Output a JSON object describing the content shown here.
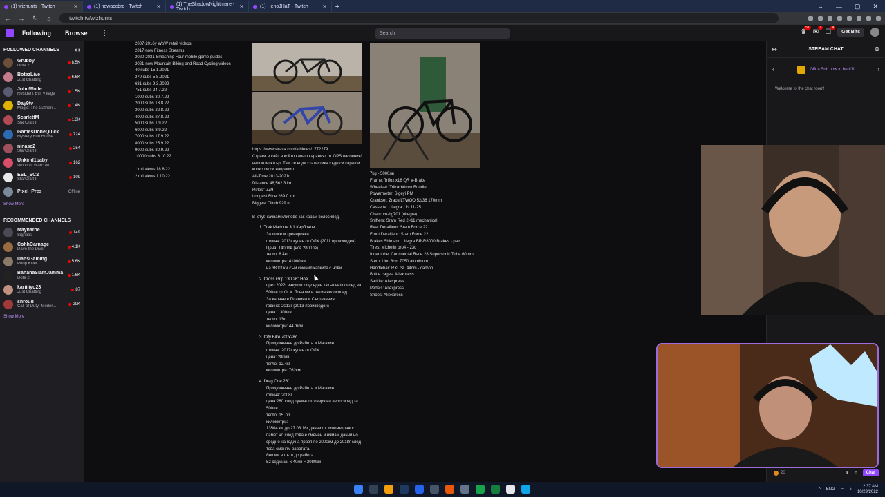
{
  "browser": {
    "tabs": [
      {
        "title": "(1) wizhunts - Twitch",
        "active": true
      },
      {
        "title": "(1) newaccbro - Twitch",
        "active": false
      },
      {
        "title": "(1) TheShadowNightmare - Twitch",
        "active": false
      },
      {
        "title": "(1) HenoJHaT - Twitch",
        "active": false
      }
    ],
    "new_tab_label": "+",
    "url": "twitch.tv/wizhunts",
    "window_controls": [
      "⌄",
      "—",
      "▢",
      "✕"
    ]
  },
  "topnav": {
    "following_label": "Following",
    "browse_label": "Browse",
    "more_label": "⋮",
    "search_placeholder": "Search",
    "search_icon": "search-icon",
    "notif_badges": [
      "51",
      "1",
      "4"
    ],
    "get_bits_label": "Get Bits"
  },
  "sidebar": {
    "followed_title": "FOLLOWED CHANNELS",
    "followed": [
      {
        "name": "Grubby",
        "game": "Dota 2",
        "viewers": "8.5K",
        "avatar_color": "#6b4f3a"
      },
      {
        "name": "BotezLive",
        "game": "Just Chatting",
        "viewers": "6.6K",
        "avatar_color": "#c47a8a"
      },
      {
        "name": "JohnWolfe",
        "game": "Resident Evil Village",
        "viewers": "1.5K",
        "avatar_color": "#5a5a70"
      },
      {
        "name": "Day9tv",
        "game": "Magic: The Gatheri...",
        "viewers": "1.4K",
        "avatar_color": "#e0b100"
      },
      {
        "name": "ScarlettM",
        "game": "StarCraft II",
        "viewers": "1.3K",
        "avatar_color": "#b04a55"
      },
      {
        "name": "GamesDoneQuick",
        "game": "Mystery Fun House",
        "viewers": "724",
        "avatar_color": "#2d6bb0"
      },
      {
        "name": "ninasc2",
        "game": "StarCraft II",
        "viewers": "254",
        "avatar_color": "#a0505c"
      },
      {
        "name": "Unkind1baby",
        "game": "World of Warcraft",
        "viewers": "162",
        "avatar_color": "#d94f6a"
      },
      {
        "name": "ESL_SC2",
        "game": "StarCraft II",
        "viewers": "109",
        "avatar_color": "#e8e8e8"
      },
      {
        "name": "Pixel_Pres",
        "game": "",
        "viewers": "Offline",
        "avatar_color": "#7a8a9a"
      }
    ],
    "show_more_label": "Show More",
    "recommended_title": "RECOMMENDED CHANNELS",
    "recommended": [
      {
        "name": "Maynarde",
        "game": "Signalis",
        "viewers": "149",
        "avatar_color": "#4a4a55"
      },
      {
        "name": "CohhCarnage",
        "game": "Dave the Diver",
        "viewers": "4.1K",
        "avatar_color": "#9a6a40"
      },
      {
        "name": "DansGaming",
        "game": "Poop Killer",
        "viewers": "5.6K",
        "avatar_color": "#8a7a6a"
      },
      {
        "name": "BananaSlamJamma",
        "game": "Dota 2",
        "viewers": "1.6K",
        "avatar_color": "#222222"
      },
      {
        "name": "kariiiiyo23",
        "game": "Just Chatting",
        "viewers": "87",
        "avatar_color": "#c09080"
      },
      {
        "name": "shroud",
        "game": "Call of Duty: Moder...",
        "viewers": "29K",
        "avatar_color": "#a03a3a"
      }
    ],
    "show_more_label_2": "Show More"
  },
  "panel": {
    "milestones": [
      "2007-2016y WoW retail videos",
      "2017-now Fitness Streams",
      "2020-2021 Smashing Four mobile game guides",
      "2021-now Mountain Biking and Road Cycling videos",
      "40 subs 15.1.2021",
      "270 subs 5.8.2021",
      "681 subs 9.3.2022",
      "751 subs 24.7.22",
      "1000 subs 30.7.22",
      "2000 subs 13.8.22",
      "3000 subs 22.8.22",
      "4000 subs 27.8.22",
      "5000 subs 1.9.22",
      "6000 subs 8.9.22",
      "7000 subs 17.9.22",
      "8000 subs 25.9.22",
      "9000 subs 30.9.22",
      "10000 subs 3.10.22",
      "",
      "1 mil views 18.8.22",
      "2 mil views 1.10.22"
    ],
    "strava": [
      "https://www.strava.com/athletes/1772279",
      "Страва е сайт в който качаш караният от GPS часовник/велокомпютър. Там се води статистика къде си карал и колко км си направил.",
      "All-Time 2013-2021г.",
      "Distance:48,562.3 km",
      "Rides:1449",
      "Longest Ride:269.0 km",
      "Biggest Climb:929 m",
      "",
      "В ютуб качвам клипове как карам велосипед."
    ],
    "bikes": [
      {
        "title": "1.  Trek Madone 3.1 Карбонов",
        "details": [
          "За шосе и тренировки.",
          "година: 2013г купен от ОЛХ (2011 произведен)",
          "Цена: 1400лв (нов 2800лв)",
          "тегло: 8.4кг",
          "километри: 41000 км",
          "на 38000км съм сменил капките с нови"
        ]
      },
      {
        "title": "2.  Cross Grip 130 26\" Нов",
        "details": [
          "през 2022г закупих още един такъв велосипед за 500лв от OLX. Това ми е петия велосипед.",
          "За каране в Планина и Състезания.",
          "година: 2013г (2013 произведен)",
          "цена: 1300лв",
          "тегло: 13кг",
          "километри: 4476км"
        ]
      },
      {
        "title": "3.  City Bike 700x28c",
        "details": [
          "Придвижване до Работа и Магазин.",
          "година: 2017г купен от ОЛХ",
          "цена: 280лв",
          "тегло: 12.4кг",
          "километри: 762км"
        ]
      },
      {
        "title": "4.  Drag One 26\"",
        "details": [
          "Придвижване до Работа и Магазин.",
          "година: 2008г",
          "цена:280 след тунинг отговаря на велосипед за 500лв",
          "тегло: 15.7кг",
          "километри:",
          "13504 км до 27.03.16г данни от километраж с памет но след това е сменен и нямам данни но средно на година правя по 2000км до 2018г след това сменям работата.",
          "8км ми е пътя до работа",
          "52 седмици х 40км = 2080км"
        ]
      }
    ],
    "specs": [
      "7kg - 5000лв",
      "Frame: Trifox x16 QR V-Brake",
      "Wheelset: Trifox 60mm Bundle",
      "Powermeter: Sigeyi PM",
      "Crankset: Zrace/LTWOO 52/36 170mm",
      "Cassette: Ultegra 11s 11-25",
      "Chain: cn-hg701 (ultegra)",
      "Shifters: Sram Red 2×11 mechanical",
      "Rear Derailleur: Sram Force 22",
      "Front Derailleur: Sram Force 22",
      "Brakes Shimano Ultegra BR-R8000 Brakes - pair",
      "Tires: Michelin pro4 - 23c",
      "Inner tube: Continental Race 28 Supersonic Tube 60mm",
      "Stem: Uno 8cm 7050 aluminum",
      "Handlebar: RXL SL 44cm - carbon",
      "Bottle cages: Aliexpress",
      "Saddle: Aliexpress",
      "Pedals: Aliexpress",
      "Shoes: Aliexpress"
    ]
  },
  "chat": {
    "title": "STREAM CHAT",
    "gift_label": "Gift a Sub now to be #1!",
    "welcome": "Welcome to the chat room!",
    "points": "20",
    "chat_button": "Chat"
  },
  "taskbar": {
    "lang": "ENG",
    "time": "2:37 AM",
    "date": "10/29/2022"
  },
  "colors": {
    "twitch_purple": "#9147ff",
    "live_red": "#eb0400"
  }
}
